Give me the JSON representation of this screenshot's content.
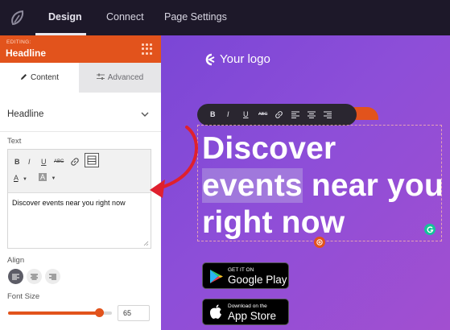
{
  "topbar": {
    "tabs": [
      {
        "label": "Design",
        "active": true
      },
      {
        "label": "Connect",
        "active": false
      },
      {
        "label": "Page Settings",
        "active": false
      }
    ]
  },
  "sidebar": {
    "editing_label": "EDITING:",
    "editing_title": "Headline",
    "subtabs": {
      "content": "Content",
      "advanced": "Advanced"
    },
    "section_title": "Headline",
    "text_label": "Text",
    "editor_value": "Discover events near you right now",
    "editor_buttons": [
      "B",
      "I",
      "U",
      "ABC",
      "link",
      "grid"
    ],
    "text_color_label": "A",
    "bg_color_label": "A",
    "align_label": "Align",
    "align_selected": "left",
    "font_size_label": "Font Size",
    "font_size_value": "65",
    "font_size_fraction": 0.88
  },
  "canvas": {
    "logo_text": "Your logo",
    "headline_before": "Discover",
    "headline_highlight": "events",
    "headline_after": " near you right now",
    "toolbar_items": [
      "B",
      "I",
      "U",
      "ABC",
      "link",
      "align-left",
      "align-center",
      "align-right"
    ],
    "google_play": {
      "small": "GET IT ON",
      "big": "Google Play"
    },
    "app_store": {
      "small": "Download on the",
      "big": "App Store"
    }
  },
  "colors": {
    "accent": "#e2531c",
    "topbar": "#1d1829",
    "canvas_start": "#7b46d6",
    "canvas_end": "#a24fd0",
    "annotation_arrow": "#e0202e"
  }
}
